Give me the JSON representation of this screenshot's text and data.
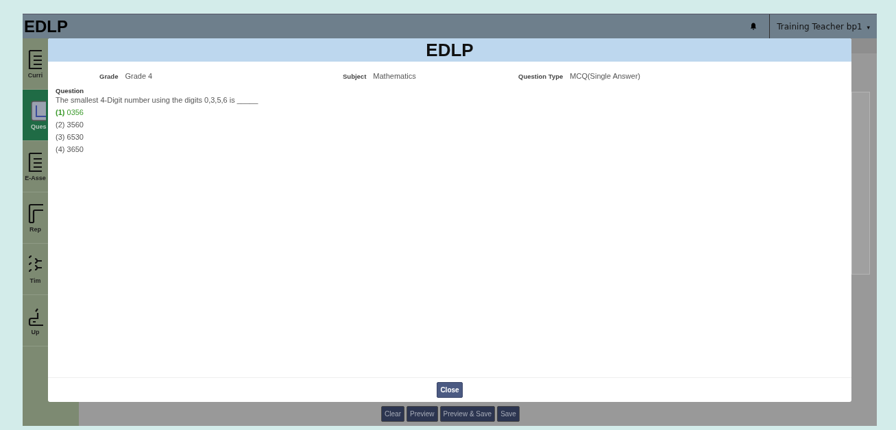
{
  "header": {
    "logo": "EDLP",
    "user": "Training Teacher bp1",
    "user_caret": "▾"
  },
  "sidebar": {
    "items": [
      {
        "label": "Curri",
        "kind": "doc",
        "selected": false
      },
      {
        "label": "Ques",
        "kind": "square",
        "selected": true
      },
      {
        "label": "E-Asse",
        "kind": "doc",
        "selected": false
      },
      {
        "label": "Rep",
        "kind": "report",
        "selected": false
      },
      {
        "label": "Tim",
        "kind": "brackets",
        "selected": false
      },
      {
        "label": "Up",
        "kind": "upload",
        "selected": false
      }
    ]
  },
  "modal": {
    "title": "EDLP",
    "meta": [
      {
        "label": "Grade",
        "value": "Grade 4"
      },
      {
        "label": "Subject",
        "value": "Mathematics"
      },
      {
        "label": "Question Type",
        "value": "MCQ(Single Answer)"
      }
    ],
    "question_label": "Question",
    "question": "The smallest 4-Digit number using the digits 0,3,5,6 is _____",
    "options": [
      {
        "number": "(1)",
        "text": "0356",
        "correct": true
      },
      {
        "number": "(2)",
        "text": "3560",
        "correct": false
      },
      {
        "number": "(3)",
        "text": "6530",
        "correct": false
      },
      {
        "number": "(4)",
        "text": "3650",
        "correct": false
      }
    ],
    "close_button": "Close"
  },
  "toolbar": {
    "buttons": [
      "Clear",
      "Preview",
      "Preview & Save",
      "Save"
    ]
  }
}
